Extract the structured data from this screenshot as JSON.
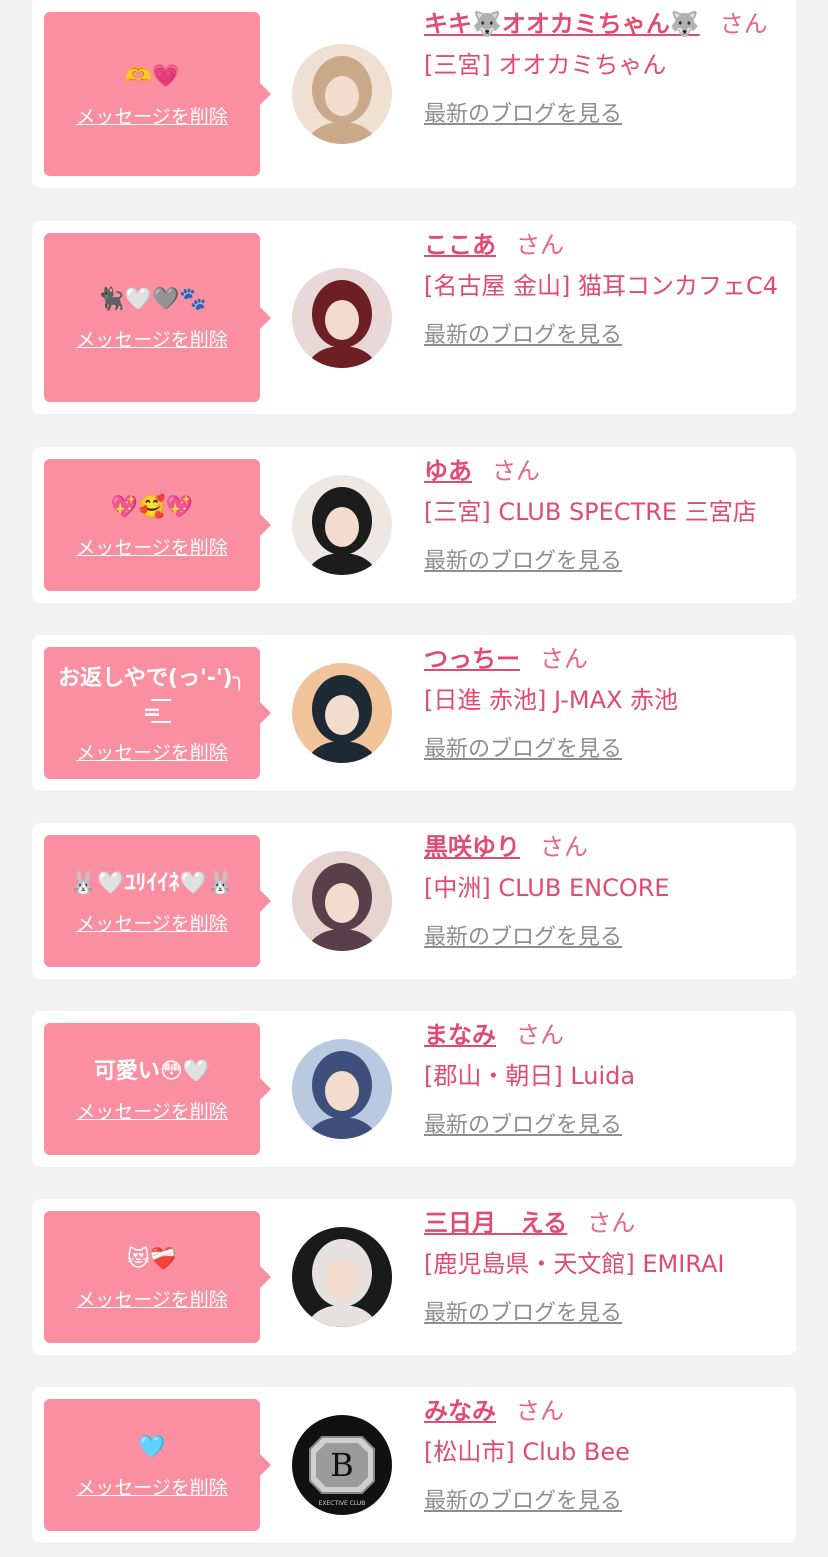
{
  "entries": [
    {
      "message": "🫶💗",
      "delete_label": "メッセージを削除",
      "name": "キキ🐺オオカミちゃん🐺",
      "honorific": "さん",
      "shop": "[三宮] オオカミちゃん",
      "blog_link": "最新のブログを見る",
      "avatar_icon": "profile-photo"
    },
    {
      "message": "🐈‍⬛🤍🩶🐾",
      "delete_label": "メッセージを削除",
      "name": "ここあ",
      "honorific": "さん",
      "shop": "[名古屋 金山] 猫耳コンカフェC4",
      "blog_link": "最新のブログを見る",
      "avatar_icon": "profile-photo"
    },
    {
      "message": "💖🥰💖",
      "delete_label": "メッセージを削除",
      "name": "ゆあ",
      "honorific": "さん",
      "shop": "[三宮] CLUB SPECTRE 三宮店",
      "blog_link": "最新のブログを見る",
      "avatar_icon": "profile-photo"
    },
    {
      "message": "お返しやで(っ'-')╮ =͟͟͞͞",
      "delete_label": "メッセージを削除",
      "name": "つっちー",
      "honorific": "さん",
      "shop": "[日進 赤池] J-MAX 赤池",
      "blog_link": "最新のブログを見る",
      "avatar_icon": "profile-photo"
    },
    {
      "message": "🐰🤍ﾕﾘｲｲﾈ🤍🐰",
      "delete_label": "メッセージを削除",
      "name": "黒咲ゆり",
      "honorific": "さん",
      "shop": "[中洲] CLUB ENCORE",
      "blog_link": "最新のブログを見る",
      "avatar_icon": "profile-photo"
    },
    {
      "message": "可愛い😳🤍",
      "delete_label": "メッセージを削除",
      "name": "まなみ",
      "honorific": "さん",
      "shop": "[郡山・朝日] Luida",
      "blog_link": "最新のブログを見る",
      "avatar_icon": "profile-photo"
    },
    {
      "message": "😻❤️‍🩹",
      "delete_label": "メッセージを削除",
      "name": "三日月　える",
      "honorific": "さん",
      "shop": "[鹿児島県・天文館] EMIRAI",
      "blog_link": "最新のブログを見る",
      "avatar_icon": "profile-photo"
    },
    {
      "message": "🩵",
      "delete_label": "メッセージを削除",
      "name": "みなみ",
      "honorific": "さん",
      "shop": "[松山市] Club Bee",
      "blog_link": "最新のブログを見る",
      "avatar_icon": "club-logo",
      "logo_letter": "B",
      "logo_text": "EXECTIVE CLUB"
    }
  ],
  "colors": {
    "bubble": "#f98fa0",
    "name": "#e14b72",
    "link_gray": "#8e8e8e",
    "background": "#f2f2f2"
  }
}
